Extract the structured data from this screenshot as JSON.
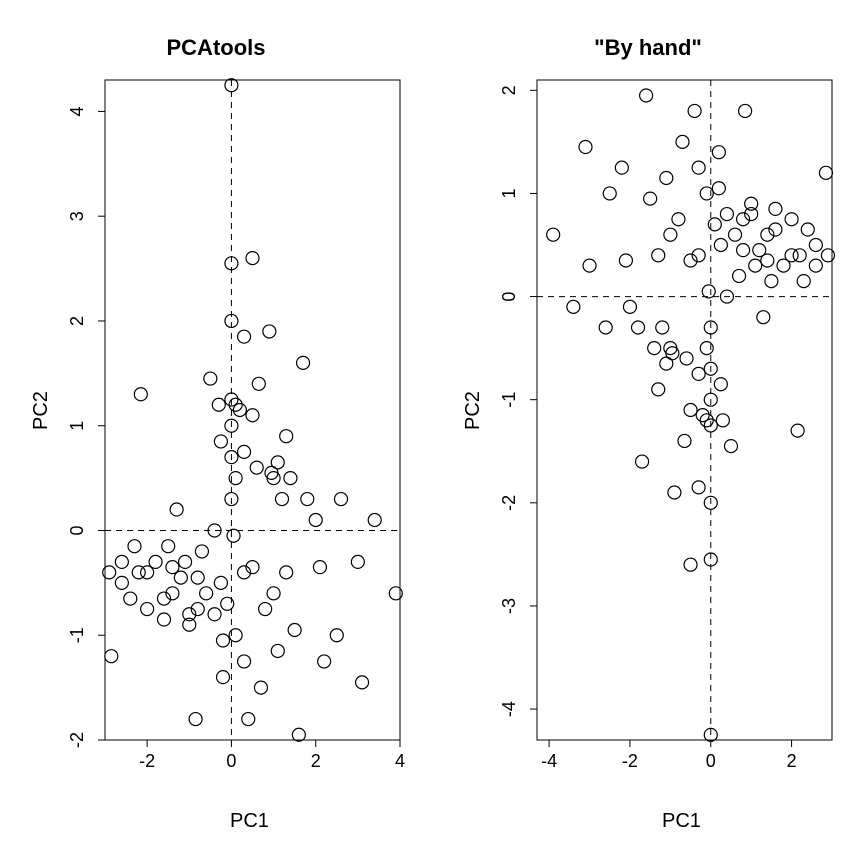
{
  "chart_data": [
    {
      "type": "scatter",
      "title": "PCAtools",
      "xlabel": "PC1",
      "ylabel": "PC2",
      "xlim": [
        -3,
        4
      ],
      "ylim": [
        -2,
        4.3
      ],
      "xticks": [
        -2,
        0,
        2,
        4
      ],
      "yticks": [
        -2,
        -1,
        0,
        1,
        2,
        3,
        4
      ],
      "hline": 0,
      "vline": 0,
      "points": [
        [
          -2.9,
          -0.4
        ],
        [
          -2.85,
          -1.2
        ],
        [
          -2.6,
          -0.5
        ],
        [
          -2.6,
          -0.3
        ],
        [
          -2.4,
          -0.65
        ],
        [
          -2.3,
          -0.15
        ],
        [
          -2.2,
          -0.4
        ],
        [
          -2.15,
          1.3
        ],
        [
          -2.0,
          -0.4
        ],
        [
          -2.0,
          -0.75
        ],
        [
          -1.8,
          -0.3
        ],
        [
          -1.6,
          -0.65
        ],
        [
          -1.6,
          -0.85
        ],
        [
          -1.5,
          -0.15
        ],
        [
          -1.4,
          -0.35
        ],
        [
          -1.4,
          -0.6
        ],
        [
          -1.3,
          0.2
        ],
        [
          -1.2,
          -0.45
        ],
        [
          -1.1,
          -0.3
        ],
        [
          -1.0,
          -0.8
        ],
        [
          -1.0,
          -0.9
        ],
        [
          -0.85,
          -1.8
        ],
        [
          -0.8,
          -0.75
        ],
        [
          -0.8,
          -0.45
        ],
        [
          -0.7,
          -0.2
        ],
        [
          -0.6,
          -0.6
        ],
        [
          -0.5,
          1.45
        ],
        [
          -0.4,
          0.0
        ],
        [
          -0.4,
          -0.8
        ],
        [
          -0.3,
          1.2
        ],
        [
          -0.25,
          0.85
        ],
        [
          -0.25,
          -0.5
        ],
        [
          -0.2,
          -1.05
        ],
        [
          -0.2,
          -1.4
        ],
        [
          -0.1,
          -0.7
        ],
        [
          0.0,
          4.25
        ],
        [
          0.0,
          2.55
        ],
        [
          0.0,
          2.0
        ],
        [
          0.0,
          1.25
        ],
        [
          0.0,
          1.0
        ],
        [
          0.0,
          0.7
        ],
        [
          0.0,
          0.3
        ],
        [
          0.05,
          -0.05
        ],
        [
          0.1,
          1.2
        ],
        [
          0.1,
          0.5
        ],
        [
          0.1,
          -1.0
        ],
        [
          0.2,
          1.15
        ],
        [
          0.3,
          1.85
        ],
        [
          0.3,
          0.75
        ],
        [
          0.3,
          -0.4
        ],
        [
          0.3,
          -1.25
        ],
        [
          0.4,
          -1.8
        ],
        [
          0.5,
          2.6
        ],
        [
          0.5,
          1.1
        ],
        [
          0.5,
          -0.35
        ],
        [
          0.6,
          0.6
        ],
        [
          0.65,
          1.4
        ],
        [
          0.7,
          -1.5
        ],
        [
          0.8,
          -0.75
        ],
        [
          0.9,
          1.9
        ],
        [
          0.95,
          0.55
        ],
        [
          1.0,
          0.5
        ],
        [
          1.0,
          -0.6
        ],
        [
          1.1,
          0.65
        ],
        [
          1.1,
          -1.15
        ],
        [
          1.2,
          0.3
        ],
        [
          1.3,
          0.9
        ],
        [
          1.3,
          -0.4
        ],
        [
          1.4,
          0.5
        ],
        [
          1.5,
          -0.95
        ],
        [
          1.6,
          -1.95
        ],
        [
          1.7,
          1.6
        ],
        [
          1.8,
          0.3
        ],
        [
          2.0,
          0.1
        ],
        [
          2.1,
          -0.35
        ],
        [
          2.2,
          -1.25
        ],
        [
          2.5,
          -1.0
        ],
        [
          2.6,
          0.3
        ],
        [
          3.0,
          -0.3
        ],
        [
          3.1,
          -1.45
        ],
        [
          3.4,
          0.1
        ],
        [
          3.9,
          -0.6
        ]
      ]
    },
    {
      "type": "scatter",
      "title": "\"By hand\"",
      "xlabel": "PC1",
      "ylabel": "PC2",
      "xlim": [
        -4.3,
        3
      ],
      "ylim": [
        -4.3,
        2.1
      ],
      "xticks": [
        -4,
        -2,
        0,
        2
      ],
      "yticks": [
        -4,
        -3,
        -2,
        -1,
        0,
        1,
        2
      ],
      "hline": 0,
      "vline": 0,
      "points": [
        [
          2.9,
          0.4
        ],
        [
          2.85,
          1.2
        ],
        [
          2.6,
          0.5
        ],
        [
          2.6,
          0.3
        ],
        [
          2.4,
          0.65
        ],
        [
          2.3,
          0.15
        ],
        [
          2.2,
          0.4
        ],
        [
          2.15,
          -1.3
        ],
        [
          2.0,
          0.4
        ],
        [
          2.0,
          0.75
        ],
        [
          1.8,
          0.3
        ],
        [
          1.6,
          0.65
        ],
        [
          1.6,
          0.85
        ],
        [
          1.5,
          0.15
        ],
        [
          1.4,
          0.35
        ],
        [
          1.4,
          0.6
        ],
        [
          1.3,
          -0.2
        ],
        [
          1.2,
          0.45
        ],
        [
          1.1,
          0.3
        ],
        [
          1.0,
          0.8
        ],
        [
          1.0,
          0.9
        ],
        [
          0.85,
          1.8
        ],
        [
          0.8,
          0.75
        ],
        [
          0.8,
          0.45
        ],
        [
          0.7,
          0.2
        ],
        [
          0.6,
          0.6
        ],
        [
          0.5,
          -1.45
        ],
        [
          0.4,
          0.0
        ],
        [
          0.4,
          0.8
        ],
        [
          0.3,
          -1.2
        ],
        [
          0.25,
          -0.85
        ],
        [
          0.25,
          0.5
        ],
        [
          0.2,
          1.05
        ],
        [
          0.2,
          1.4
        ],
        [
          0.1,
          0.7
        ],
        [
          0.0,
          -4.25
        ],
        [
          0.0,
          -2.55
        ],
        [
          0.0,
          -2.0
        ],
        [
          0.0,
          -1.25
        ],
        [
          0.0,
          -1.0
        ],
        [
          0.0,
          -0.7
        ],
        [
          0.0,
          -0.3
        ],
        [
          -0.05,
          0.05
        ],
        [
          -0.1,
          -1.2
        ],
        [
          -0.1,
          -0.5
        ],
        [
          -0.1,
          1.0
        ],
        [
          -0.2,
          -1.15
        ],
        [
          -0.3,
          -1.85
        ],
        [
          -0.3,
          -0.75
        ],
        [
          -0.3,
          0.4
        ],
        [
          -0.3,
          1.25
        ],
        [
          -0.4,
          1.8
        ],
        [
          -0.5,
          -2.6
        ],
        [
          -0.5,
          -1.1
        ],
        [
          -0.5,
          0.35
        ],
        [
          -0.6,
          -0.6
        ],
        [
          -0.65,
          -1.4
        ],
        [
          -0.7,
          1.5
        ],
        [
          -0.8,
          0.75
        ],
        [
          -0.9,
          -1.9
        ],
        [
          -0.95,
          -0.55
        ],
        [
          -1.0,
          -0.5
        ],
        [
          -1.0,
          0.6
        ],
        [
          -1.1,
          -0.65
        ],
        [
          -1.1,
          1.15
        ],
        [
          -1.2,
          -0.3
        ],
        [
          -1.3,
          -0.9
        ],
        [
          -1.3,
          0.4
        ],
        [
          -1.4,
          -0.5
        ],
        [
          -1.5,
          0.95
        ],
        [
          -1.6,
          1.95
        ],
        [
          -1.7,
          -1.6
        ],
        [
          -1.8,
          -0.3
        ],
        [
          -2.0,
          -0.1
        ],
        [
          -2.1,
          0.35
        ],
        [
          -2.2,
          1.25
        ],
        [
          -2.5,
          1.0
        ],
        [
          -2.6,
          -0.3
        ],
        [
          -3.0,
          0.3
        ],
        [
          -3.1,
          1.45
        ],
        [
          -3.4,
          -0.1
        ],
        [
          -3.9,
          0.6
        ]
      ]
    }
  ]
}
